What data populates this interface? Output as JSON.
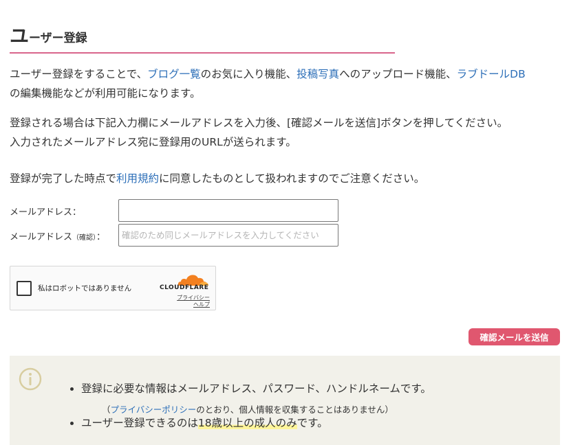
{
  "heading": {
    "first_char": "ユ",
    "rest": "ーザー登録"
  },
  "intro": {
    "pre": "ユーザー登録をすることで、",
    "link1": "ブログ一覧",
    "mid1": "のお気に入り機能、",
    "link2": "投稿写真",
    "mid2": "へのアップロード機能、",
    "link3": "ラブドールDB",
    "line2": "の編集機能などが利用可能になります。"
  },
  "instructions": {
    "line1": "登録される場合は下記入力欄にメールアドレスを入力後、[確認メールを送信]ボタンを押してください。",
    "line2": "入力されたメールアドレス宛に登録用のURLが送られます。"
  },
  "terms": {
    "pre": "登録が完了した時点で",
    "link": "利用規約",
    "post": "に同意したものとして扱われますのでご注意ください。"
  },
  "form": {
    "email_label": "メールアドレス：",
    "confirm_label_main": "メールアドレス",
    "confirm_label_note": "（確認）",
    "confirm_label_colon": "：",
    "email_value": "",
    "confirm_value": "",
    "confirm_placeholder": "確認のため同じメールアドレスを入力してください"
  },
  "captcha": {
    "label": "私はロボットではありません",
    "brand": "CLOUDFLARE",
    "privacy": "プライバシー",
    "help": "ヘルプ"
  },
  "send_button": "確認メールを送信",
  "notice": {
    "item1": "登録に必要な情報はメールアドレス、パスワード、ハンドルネームです。",
    "sub_pre": "（",
    "sub_link": "プライバシーポリシー",
    "sub_post": "のとおり、個人情報を収集することはありません）",
    "item2_pre": "ユーザー登録できるのは",
    "item2_hl": "18歳以上の成人のみ",
    "item2_post": "です。"
  },
  "colors": {
    "accent": "#d9648a",
    "button": "#e0576f",
    "link": "#2d6fb8",
    "notice_bg": "#f2f1ea",
    "cloudflare": "#f38020"
  },
  "icons": {
    "notice": "info-icon",
    "captcha": "cloudflare-cloud-icon"
  }
}
